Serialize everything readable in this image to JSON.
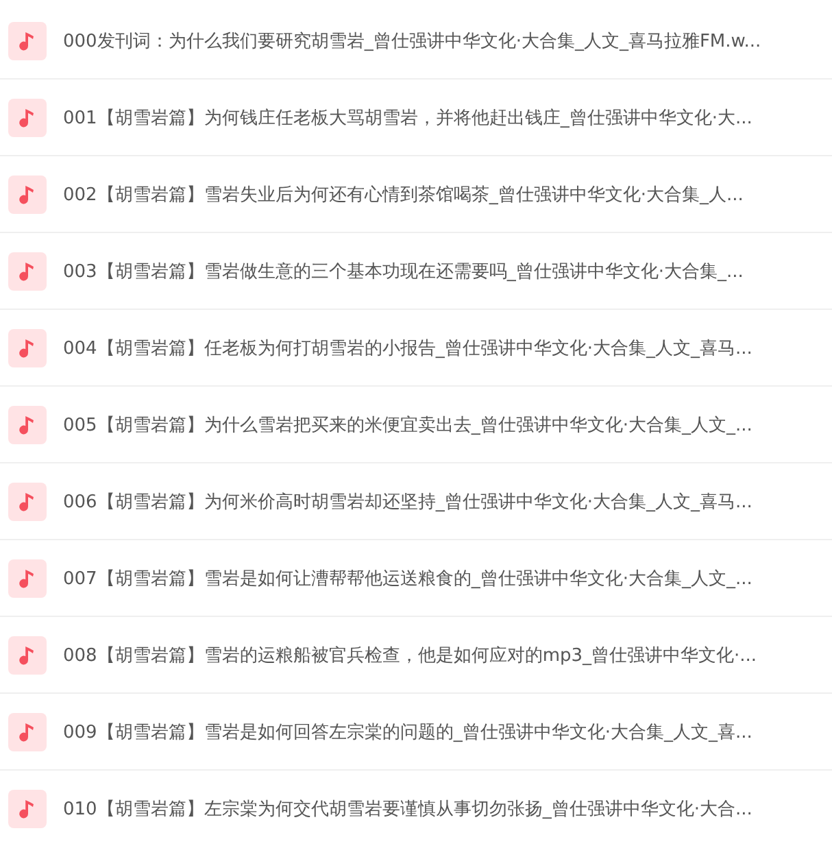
{
  "tracks": [
    {
      "title": "000发刊词：为什么我们要研究胡雪岩_曾仕强讲中华文化·大合集_人文_喜马拉雅FM.w..."
    },
    {
      "title": "001【胡雪岩篇】为何钱庄任老板大骂胡雪岩，并将他赶出钱庄_曾仕强讲中华文化·大..."
    },
    {
      "title": "002【胡雪岩篇】雪岩失业后为何还有心情到茶馆喝茶_曾仕强讲中华文化·大合集_人..."
    },
    {
      "title": "003【胡雪岩篇】雪岩做生意的三个基本功现在还需要吗_曾仕强讲中华文化·大合集_..."
    },
    {
      "title": "004【胡雪岩篇】任老板为何打胡雪岩的小报告_曾仕强讲中华文化·大合集_人文_喜马..."
    },
    {
      "title": "005【胡雪岩篇】为什么雪岩把买来的米便宜卖出去_曾仕强讲中华文化·大合集_人文_..."
    },
    {
      "title": "006【胡雪岩篇】为何米价高时胡雪岩却还坚持_曾仕强讲中华文化·大合集_人文_喜马..."
    },
    {
      "title": "007【胡雪岩篇】雪岩是如何让漕帮帮他运送粮食的_曾仕强讲中华文化·大合集_人文_..."
    },
    {
      "title": "008【胡雪岩篇】雪岩的运粮船被官兵检查，他是如何应对的mp3_曾仕强讲中华文化·..."
    },
    {
      "title": "009【胡雪岩篇】雪岩是如何回答左宗棠的问题的_曾仕强讲中华文化·大合集_人文_喜..."
    },
    {
      "title": "010【胡雪岩篇】左宗棠为何交代胡雪岩要谨慎从事切勿张扬_曾仕强讲中华文化·大合..."
    }
  ]
}
